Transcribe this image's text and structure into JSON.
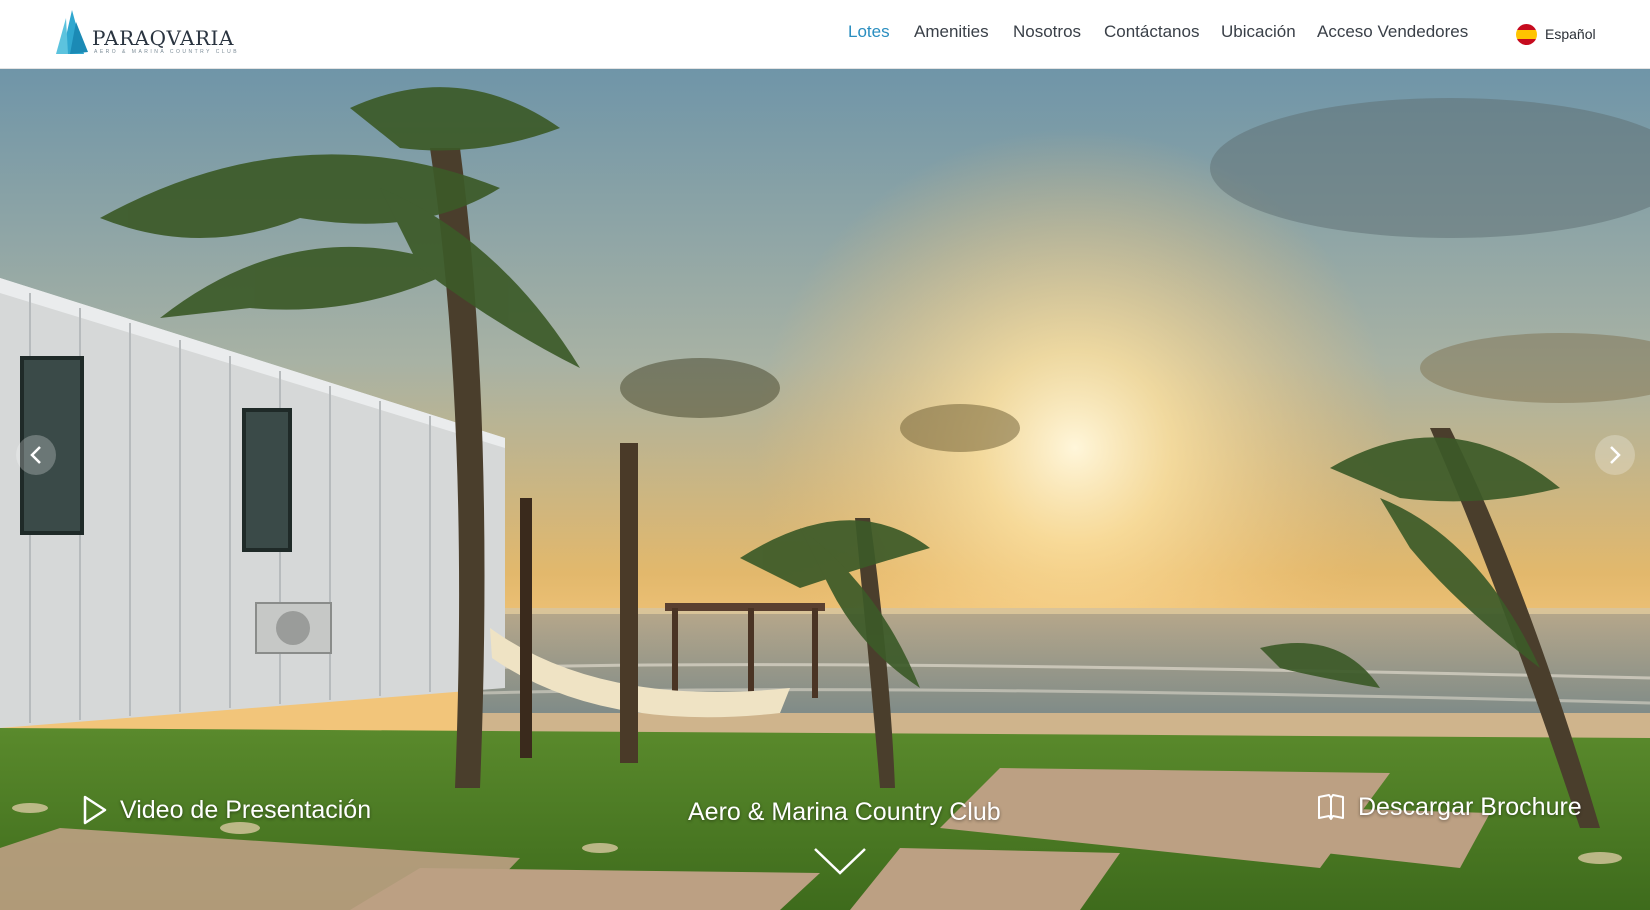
{
  "header": {
    "logo": {
      "text": "PARAQVARIA",
      "subtitle": "AERO & MARINA COUNTRY CLUB",
      "icon": "sail-logo-icon"
    },
    "nav": [
      {
        "label": "Lotes",
        "active": true
      },
      {
        "label": "Amenities",
        "active": false
      },
      {
        "label": "Nosotros",
        "active": false
      },
      {
        "label": "Contáctanos",
        "active": false
      },
      {
        "label": "Ubicación",
        "active": false
      },
      {
        "label": "Acceso Vendedores",
        "active": false
      }
    ],
    "language": {
      "label": "Español",
      "icon": "spain-flag-icon"
    }
  },
  "hero": {
    "video_label": "Video de Presentación",
    "title": "Aero & Marina Country Club",
    "brochure_label": "Descargar Brochure",
    "prev_icon": "chevron-left-icon",
    "next_icon": "chevron-right-icon",
    "scroll_icon": "chevron-down-icon"
  },
  "colors": {
    "accent": "#2a8ec0",
    "nav_text": "#3a4048"
  }
}
